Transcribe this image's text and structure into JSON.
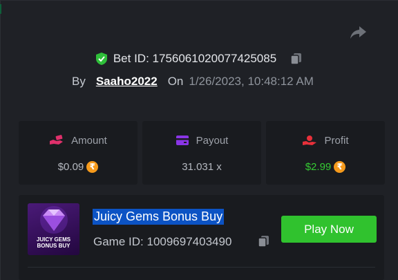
{
  "header": {
    "share_icon": "share-arrow-icon",
    "bet_label": "Bet ID:",
    "bet_id": "1756061020077425085",
    "verified_icon": "shield-check-icon",
    "copy_icon": "copy-icon"
  },
  "meta": {
    "by_label": "By",
    "username": "Saaho2022",
    "on_label": "On",
    "date": "1/26/2023, 10:48:12 AM"
  },
  "stats": {
    "amount": {
      "label": "Amount",
      "value": "$0.09",
      "icon": "hand-money-icon",
      "currency_icon": "rupee-coin-icon",
      "currency_glyph": "₹"
    },
    "payout": {
      "label": "Payout",
      "value": "31.031 x",
      "icon": "wallet-card-icon"
    },
    "profit": {
      "label": "Profit",
      "value": "$2.99",
      "icon": "hand-coin-icon",
      "currency_icon": "rupee-coin-icon",
      "currency_glyph": "₹"
    }
  },
  "game": {
    "name": "Juicy Gems Bonus Buy",
    "id_label": "Game ID:",
    "id": "1009697403490",
    "thumbnail_lines": [
      "JUICY GEMS",
      "BONUS BUY"
    ],
    "play_label": "Play Now",
    "copy_icon": "copy-icon"
  },
  "colors": {
    "background": "#1f2126",
    "card": "#191b1f",
    "accent_green": "#30c22e",
    "profit_green": "#35cb33",
    "amount_pink": "#e0306b",
    "payout_purple": "#8a35e6",
    "profit_red": "#e8303a",
    "coin_orange": "#f59a1c",
    "selection_blue": "#0c53c4"
  }
}
